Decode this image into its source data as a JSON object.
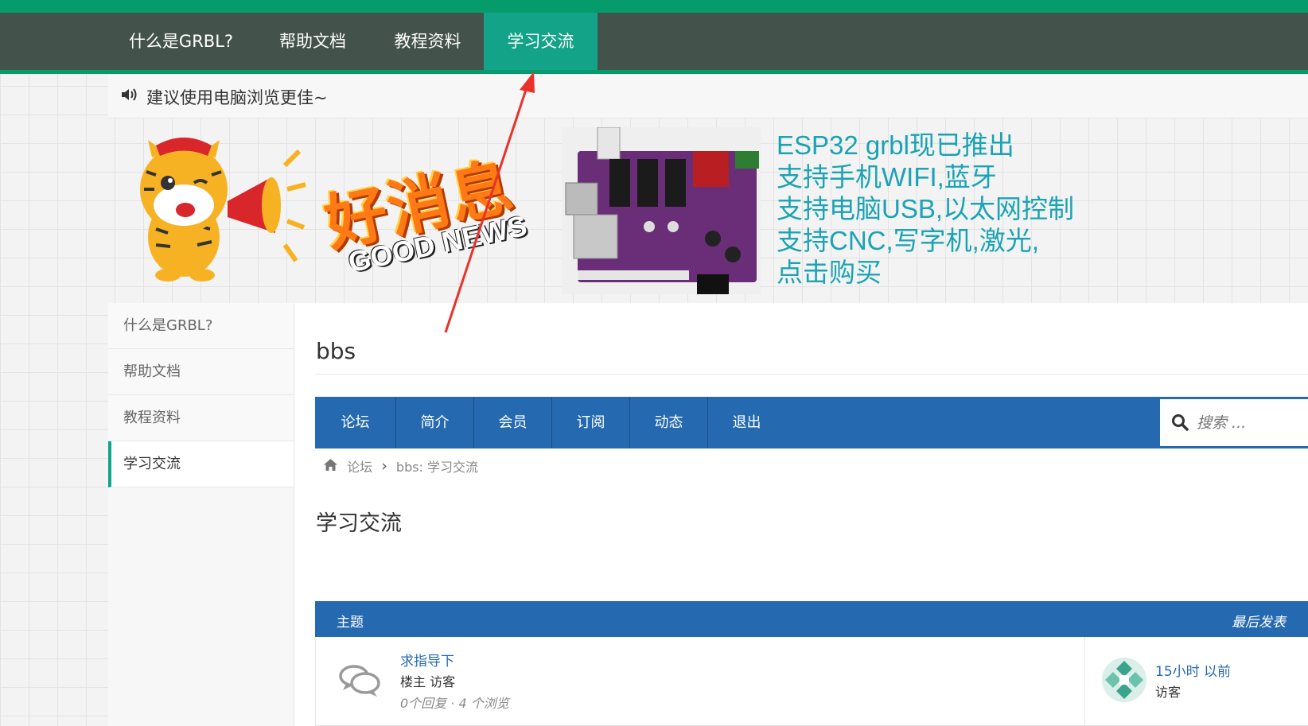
{
  "nav": {
    "items": [
      {
        "label": "什么是GRBL?"
      },
      {
        "label": "帮助文档"
      },
      {
        "label": "教程资料"
      },
      {
        "label": "学习交流"
      }
    ],
    "active_index": 3
  },
  "notice": {
    "icon": "speaker-icon",
    "text": "建议使用电脑浏览更佳~"
  },
  "banner": {
    "badge_main": "好消息",
    "badge_sub": "GOOD NEWS",
    "lines": [
      "ESP32 grbl现已推出",
      "支持手机WIFI,蓝牙",
      "支持电脑USB,以太网控制",
      "支持CNC,写字机,激光,",
      "点击购买"
    ]
  },
  "sidebar": {
    "items": [
      {
        "label": "什么是GRBL?"
      },
      {
        "label": "帮助文档"
      },
      {
        "label": "教程资料"
      },
      {
        "label": "学习交流"
      }
    ],
    "active_index": 3
  },
  "main": {
    "title": "bbs",
    "forum_nav": [
      {
        "label": "论坛"
      },
      {
        "label": "简介"
      },
      {
        "label": "会员"
      },
      {
        "label": "订阅"
      },
      {
        "label": "动态"
      },
      {
        "label": "退出"
      }
    ],
    "search": {
      "placeholder": "搜索 ..."
    },
    "breadcrumb": {
      "home": "论坛",
      "separator": "›",
      "current": "bbs: 学习交流"
    },
    "heading": "学习交流",
    "table": {
      "header_topic": "主题",
      "header_last": "最后发表",
      "rows": [
        {
          "title": "求指导下",
          "author_label": "楼主",
          "author": "访客",
          "stats": "0个回复 · 4 个浏览",
          "last_time": "15小时 以前",
          "last_user": "访客"
        }
      ]
    }
  },
  "colors": {
    "accent_green": "#059b6b",
    "nav_dark": "#44524c",
    "active_teal": "#12a388",
    "forum_blue": "#2569b0",
    "banner_text": "#1aa3b4",
    "annotation_red": "#e8322b"
  }
}
